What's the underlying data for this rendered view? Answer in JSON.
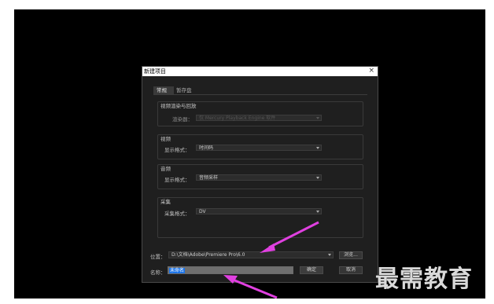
{
  "dialog": {
    "title": "新建项目",
    "close_glyph": "×",
    "tabs": [
      {
        "label": "常规",
        "active": true
      },
      {
        "label": "暂存盘",
        "active": false
      }
    ],
    "video_render": {
      "title": "视频渲染与回放",
      "renderer_label": "渲染器：",
      "renderer_value": "仅 Mercury Playback Engine 软件",
      "renderer_enabled": false
    },
    "video": {
      "title": "视频",
      "display_label": "显示格式：",
      "display_value": "时间码"
    },
    "audio": {
      "title": "音频",
      "display_label": "显示格式：",
      "display_value": "音频采样"
    },
    "capture": {
      "title": "采集",
      "format_label": "采集格式：",
      "format_value": "DV"
    },
    "location": {
      "label": "位置：",
      "value": "D:\\文档\\Adobe\\Premiere Pro\\6.0",
      "browse_label": "浏览..."
    },
    "name": {
      "label": "名称：",
      "value": "未命名"
    },
    "ok_label": "确定",
    "cancel_label": "取消"
  },
  "watermark": "最需教育",
  "colors": {
    "annotation_arrow": "#e040e0",
    "selection": "#1a73e8",
    "dialog_bg": "#1f1f1f"
  }
}
